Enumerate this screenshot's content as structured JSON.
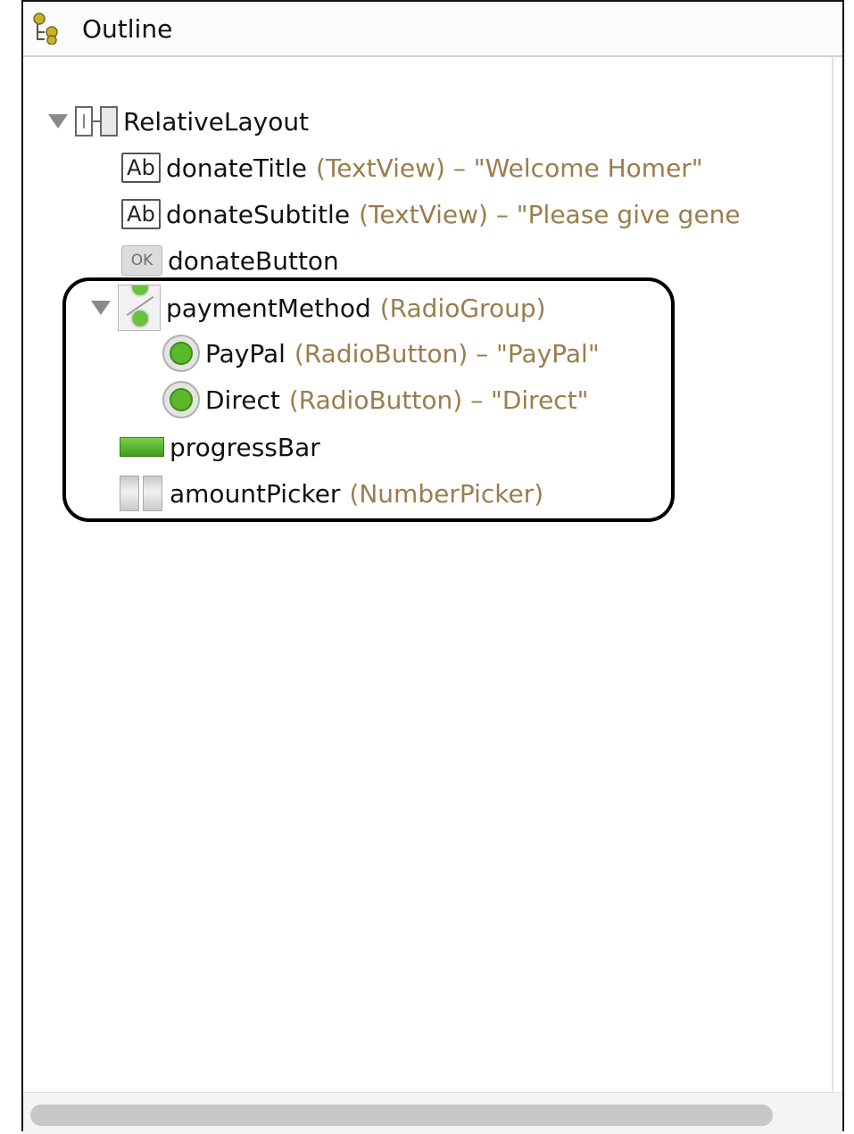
{
  "panel": {
    "title": "Outline",
    "icon": "outline-tree-icon"
  },
  "tree": {
    "root": {
      "name": "RelativeLayout",
      "icon": "relative-layout-icon",
      "expanded": true
    },
    "items": [
      {
        "name": "donateTitle",
        "type": "(TextView) – \"Welcome Homer\"",
        "icon": "textview-icon",
        "icon_text": "Ab"
      },
      {
        "name": "donateSubtitle",
        "type": "(TextView) – \"Please give gene",
        "icon": "textview-icon",
        "icon_text": "Ab"
      },
      {
        "name": "donateButton",
        "type": "",
        "icon": "button-icon",
        "icon_text": "OK"
      },
      {
        "name": "paymentMethod",
        "type": "(RadioGroup)",
        "icon": "radiogroup-icon",
        "expanded": true
      },
      {
        "name": "PayPal",
        "type": "(RadioButton) – \"PayPal\"",
        "icon": "radiobutton-icon"
      },
      {
        "name": "Direct",
        "type": "(RadioButton) – \"Direct\"",
        "icon": "radiobutton-icon"
      },
      {
        "name": "progressBar",
        "type": "",
        "icon": "progressbar-icon"
      },
      {
        "name": "amountPicker",
        "type": "(NumberPicker)",
        "icon": "numberpicker-icon"
      }
    ]
  },
  "colors": {
    "type_text": "#9b7d4d",
    "radio_green": "#5cb82b"
  }
}
